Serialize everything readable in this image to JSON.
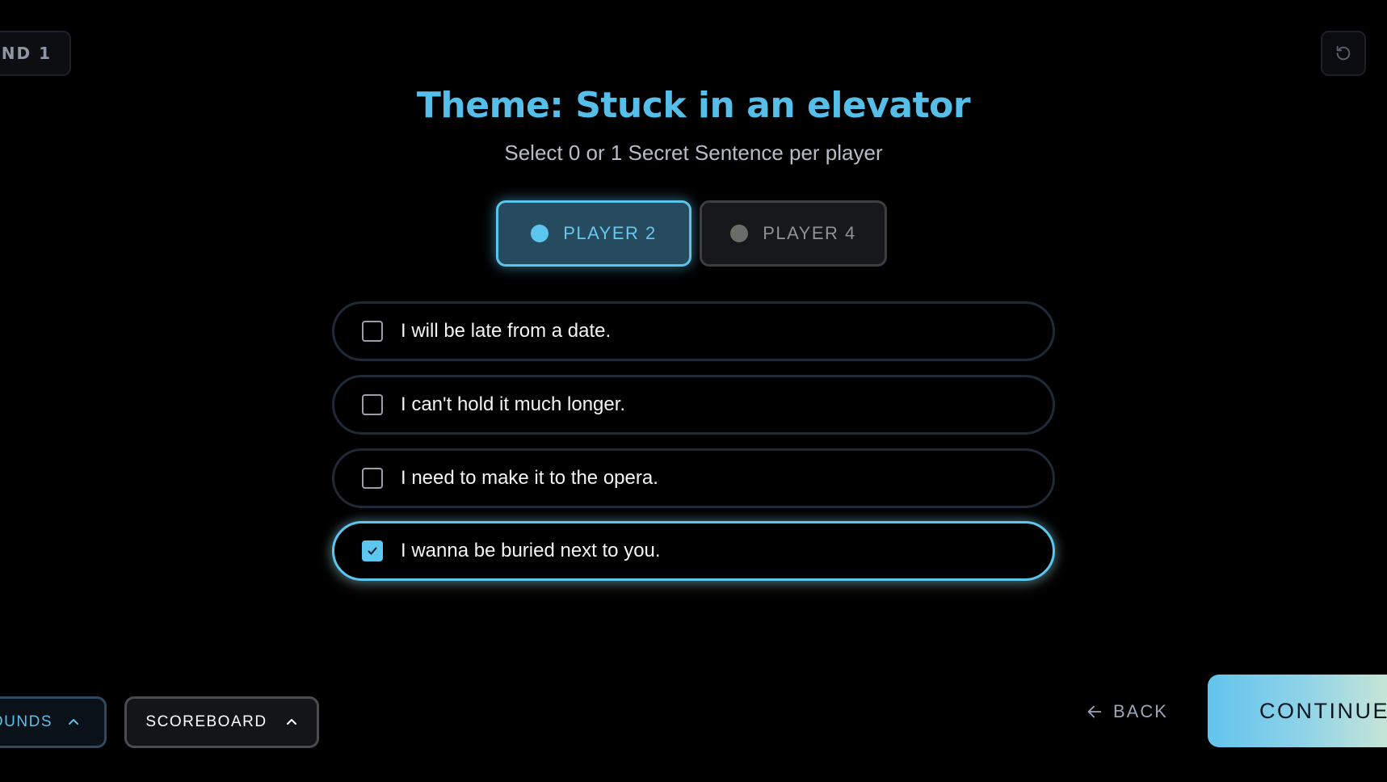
{
  "header": {
    "round_label": "UND 1",
    "reset_icon": "reset-icon"
  },
  "main": {
    "title": "Theme: Stuck in an elevator",
    "subtitle": "Select 0 or 1 Secret Sentence per player"
  },
  "players": [
    {
      "label": "PLAYER 2",
      "active": true,
      "dot_color": "#5cc6f0"
    },
    {
      "label": "PLAYER 4",
      "active": false,
      "dot_color": "#6a6c68"
    }
  ],
  "sentences": [
    {
      "text": "I will be late from a date.",
      "checked": false
    },
    {
      "text": "I can't hold it much longer.",
      "checked": false
    },
    {
      "text": "I need to make it to the opera.",
      "checked": false
    },
    {
      "text": "I wanna be buried next to you.",
      "checked": true
    }
  ],
  "footer": {
    "rounds_label": "OUNDS",
    "scoreboard_label": "SCOREBOARD",
    "back_label": "BACK",
    "continue_label": "CONTINUE"
  },
  "colors": {
    "accent": "#56bfe9",
    "background": "#000000"
  }
}
